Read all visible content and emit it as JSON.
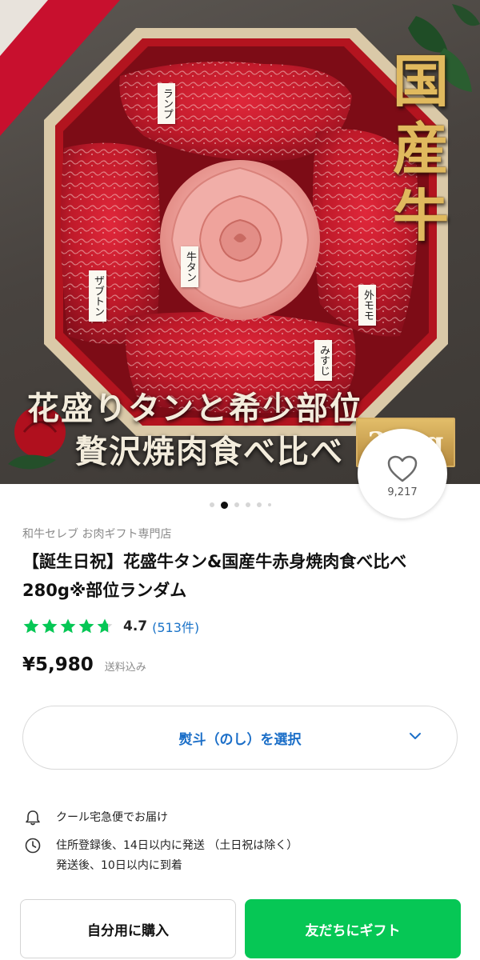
{
  "hero": {
    "kanji": [
      "国",
      "産",
      "牛"
    ],
    "caption_line1": "花盛りタンと希少部位",
    "caption_line2": "贅沢焼肉食べ比べ",
    "weight_badge": "280g",
    "labels": {
      "rump": "ランプ",
      "zabuton": "ザブトン",
      "tongue": "牛タン",
      "sotomomo": "外モモ",
      "misuji": "みすじ"
    }
  },
  "favorite": {
    "icon": "heart-icon",
    "count": "9,217"
  },
  "gallery": {
    "total_images": 6,
    "active_index": 1
  },
  "product": {
    "shop_name": "和牛セレブ お肉ギフト専門店",
    "title": "【誕生日祝】花盛牛タン&国産牛赤身焼肉食べ比べ 280g※部位ランダム",
    "rating": 4.7,
    "rating_text": "4.7",
    "review_count": "(513件)",
    "price": "¥5,980",
    "shipping_note": "送料込み"
  },
  "noshi_select": {
    "label": "熨斗（のし）を選択",
    "icon": "chevron-down-icon"
  },
  "delivery": {
    "method": "クール宅急便でお届け",
    "schedule_line1": "住所登録後、14日以内に発送 （土日祝は除く）",
    "schedule_line2": "発送後、10日以内に到着"
  },
  "actions": {
    "buy_for_self": "自分用に購入",
    "gift_to_friend": "友だちにギフト"
  },
  "colors": {
    "accent_green": "#06c755",
    "link_blue": "#1c6fc8",
    "star_green": "#06c755",
    "kanji_gold": "#e0b95e"
  }
}
